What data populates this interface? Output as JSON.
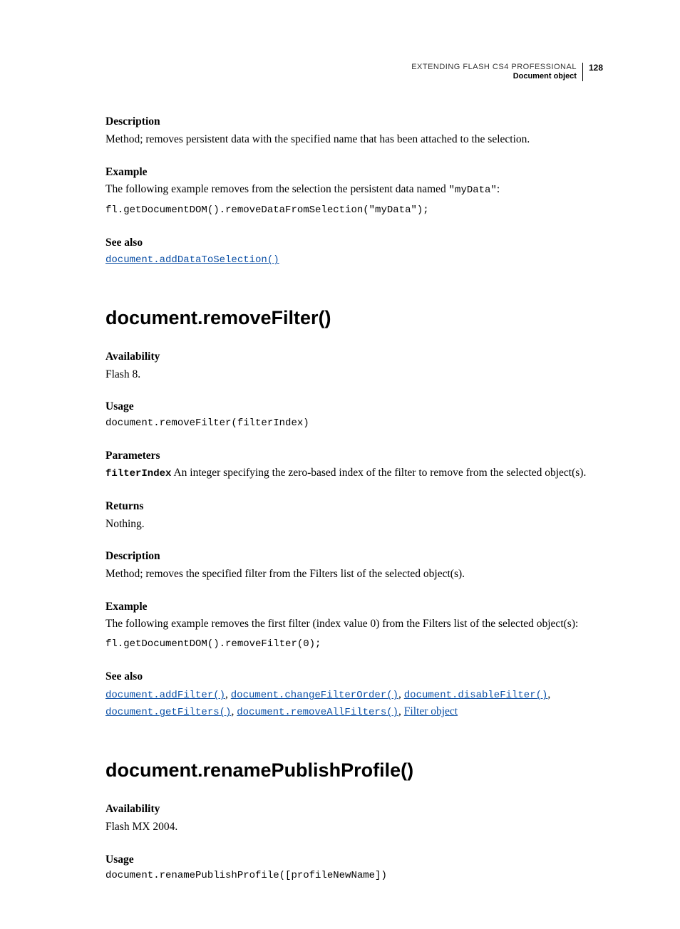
{
  "header": {
    "title": "EXTENDING FLASH CS4 PROFESSIONAL",
    "subtitle": "Document object",
    "page_number": "128"
  },
  "section1": {
    "h_description": "Description",
    "description": "Method; removes persistent data with the specified name that has been attached to the selection.",
    "h_example": "Example",
    "example_text_pre": "The following example removes from the selection the persistent data named ",
    "example_text_code": "\"myData\"",
    "example_text_post": ":",
    "example_code": "fl.getDocumentDOM().removeDataFromSelection(\"myData\");",
    "h_see_also": "See also",
    "see_also_link": "document.addDataToSelection()"
  },
  "section2": {
    "heading": "document.removeFilter()",
    "h_availability": "Availability",
    "availability": "Flash 8.",
    "h_usage": "Usage",
    "usage_code": "document.removeFilter(filterIndex)",
    "h_parameters": "Parameters",
    "param_name": "filterIndex",
    "param_desc": "  An integer specifying the zero-based index of the filter to remove from the selected object(s).",
    "h_returns": "Returns",
    "returns": "Nothing.",
    "h_description": "Description",
    "description": "Method; removes the specified filter from the Filters list of the selected object(s).",
    "h_example": "Example",
    "example_text": "The following example removes the first filter (index value 0) from the Filters list of the selected object(s):",
    "example_code": "fl.getDocumentDOM().removeFilter(0);",
    "h_see_also": "See also",
    "see_also": {
      "l1": "document.addFilter()",
      "l2": "document.changeFilterOrder()",
      "l3": "document.disableFilter()",
      "l4": "document.getFilters()",
      "l5": "document.removeAllFilters()",
      "l6": "Filter object"
    }
  },
  "section3": {
    "heading": "document.renamePublishProfile()",
    "h_availability": "Availability",
    "availability": "Flash MX 2004.",
    "h_usage": "Usage",
    "usage_code": "document.renamePublishProfile([profileNewName])"
  }
}
